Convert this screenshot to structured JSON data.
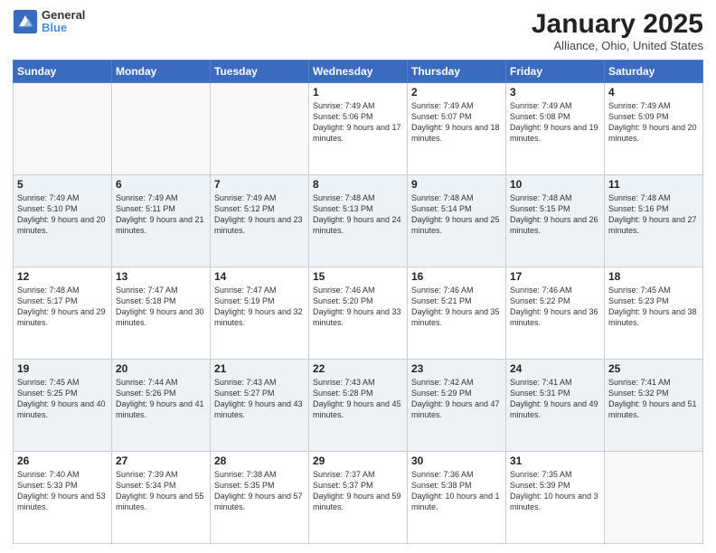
{
  "header": {
    "logo_line1": "General",
    "logo_line2": "Blue",
    "month_title": "January 2025",
    "location": "Alliance, Ohio, United States"
  },
  "weekdays": [
    "Sunday",
    "Monday",
    "Tuesday",
    "Wednesday",
    "Thursday",
    "Friday",
    "Saturday"
  ],
  "weeks": [
    [
      {
        "day": "",
        "info": ""
      },
      {
        "day": "",
        "info": ""
      },
      {
        "day": "",
        "info": ""
      },
      {
        "day": "1",
        "info": "Sunrise: 7:49 AM\nSunset: 5:06 PM\nDaylight: 9 hours and 17 minutes."
      },
      {
        "day": "2",
        "info": "Sunrise: 7:49 AM\nSunset: 5:07 PM\nDaylight: 9 hours and 18 minutes."
      },
      {
        "day": "3",
        "info": "Sunrise: 7:49 AM\nSunset: 5:08 PM\nDaylight: 9 hours and 19 minutes."
      },
      {
        "day": "4",
        "info": "Sunrise: 7:49 AM\nSunset: 5:09 PM\nDaylight: 9 hours and 20 minutes."
      }
    ],
    [
      {
        "day": "5",
        "info": "Sunrise: 7:49 AM\nSunset: 5:10 PM\nDaylight: 9 hours and 20 minutes."
      },
      {
        "day": "6",
        "info": "Sunrise: 7:49 AM\nSunset: 5:11 PM\nDaylight: 9 hours and 21 minutes."
      },
      {
        "day": "7",
        "info": "Sunrise: 7:49 AM\nSunset: 5:12 PM\nDaylight: 9 hours and 23 minutes."
      },
      {
        "day": "8",
        "info": "Sunrise: 7:48 AM\nSunset: 5:13 PM\nDaylight: 9 hours and 24 minutes."
      },
      {
        "day": "9",
        "info": "Sunrise: 7:48 AM\nSunset: 5:14 PM\nDaylight: 9 hours and 25 minutes."
      },
      {
        "day": "10",
        "info": "Sunrise: 7:48 AM\nSunset: 5:15 PM\nDaylight: 9 hours and 26 minutes."
      },
      {
        "day": "11",
        "info": "Sunrise: 7:48 AM\nSunset: 5:16 PM\nDaylight: 9 hours and 27 minutes."
      }
    ],
    [
      {
        "day": "12",
        "info": "Sunrise: 7:48 AM\nSunset: 5:17 PM\nDaylight: 9 hours and 29 minutes."
      },
      {
        "day": "13",
        "info": "Sunrise: 7:47 AM\nSunset: 5:18 PM\nDaylight: 9 hours and 30 minutes."
      },
      {
        "day": "14",
        "info": "Sunrise: 7:47 AM\nSunset: 5:19 PM\nDaylight: 9 hours and 32 minutes."
      },
      {
        "day": "15",
        "info": "Sunrise: 7:46 AM\nSunset: 5:20 PM\nDaylight: 9 hours and 33 minutes."
      },
      {
        "day": "16",
        "info": "Sunrise: 7:46 AM\nSunset: 5:21 PM\nDaylight: 9 hours and 35 minutes."
      },
      {
        "day": "17",
        "info": "Sunrise: 7:46 AM\nSunset: 5:22 PM\nDaylight: 9 hours and 36 minutes."
      },
      {
        "day": "18",
        "info": "Sunrise: 7:45 AM\nSunset: 5:23 PM\nDaylight: 9 hours and 38 minutes."
      }
    ],
    [
      {
        "day": "19",
        "info": "Sunrise: 7:45 AM\nSunset: 5:25 PM\nDaylight: 9 hours and 40 minutes."
      },
      {
        "day": "20",
        "info": "Sunrise: 7:44 AM\nSunset: 5:26 PM\nDaylight: 9 hours and 41 minutes."
      },
      {
        "day": "21",
        "info": "Sunrise: 7:43 AM\nSunset: 5:27 PM\nDaylight: 9 hours and 43 minutes."
      },
      {
        "day": "22",
        "info": "Sunrise: 7:43 AM\nSunset: 5:28 PM\nDaylight: 9 hours and 45 minutes."
      },
      {
        "day": "23",
        "info": "Sunrise: 7:42 AM\nSunset: 5:29 PM\nDaylight: 9 hours and 47 minutes."
      },
      {
        "day": "24",
        "info": "Sunrise: 7:41 AM\nSunset: 5:31 PM\nDaylight: 9 hours and 49 minutes."
      },
      {
        "day": "25",
        "info": "Sunrise: 7:41 AM\nSunset: 5:32 PM\nDaylight: 9 hours and 51 minutes."
      }
    ],
    [
      {
        "day": "26",
        "info": "Sunrise: 7:40 AM\nSunset: 5:33 PM\nDaylight: 9 hours and 53 minutes."
      },
      {
        "day": "27",
        "info": "Sunrise: 7:39 AM\nSunset: 5:34 PM\nDaylight: 9 hours and 55 minutes."
      },
      {
        "day": "28",
        "info": "Sunrise: 7:38 AM\nSunset: 5:35 PM\nDaylight: 9 hours and 57 minutes."
      },
      {
        "day": "29",
        "info": "Sunrise: 7:37 AM\nSunset: 5:37 PM\nDaylight: 9 hours and 59 minutes."
      },
      {
        "day": "30",
        "info": "Sunrise: 7:36 AM\nSunset: 5:38 PM\nDaylight: 10 hours and 1 minute."
      },
      {
        "day": "31",
        "info": "Sunrise: 7:35 AM\nSunset: 5:39 PM\nDaylight: 10 hours and 3 minutes."
      },
      {
        "day": "",
        "info": ""
      }
    ]
  ]
}
